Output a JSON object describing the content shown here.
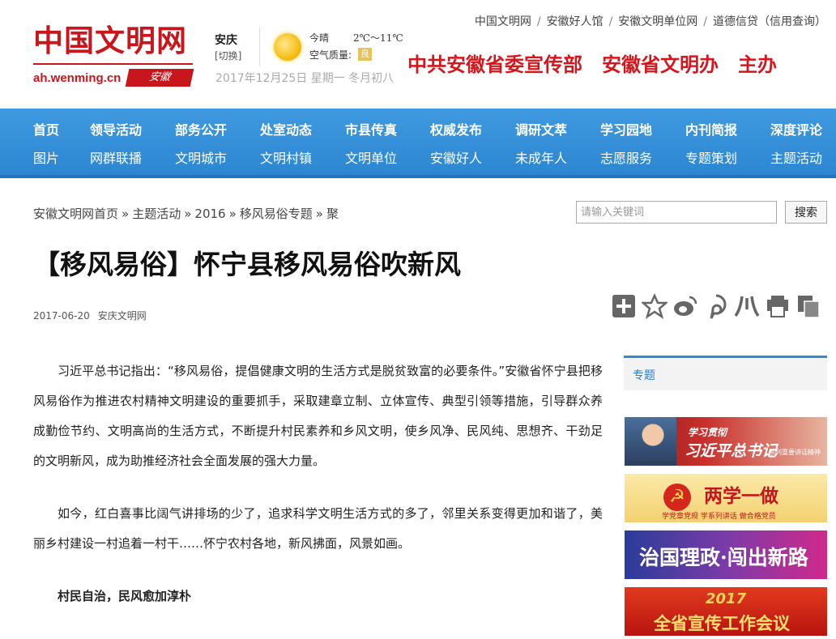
{
  "header": {
    "logo_title": "中国文明网",
    "logo_domain": "ah.wenming.cn",
    "logo_region": "安徽",
    "city": "安庆",
    "city_switch": "[切换]",
    "weather_now": "今晴",
    "weather_temp": "2℃～11℃",
    "air_label": "空气质量:",
    "air_value": "良",
    "date_line": "2017年12月25日  星期一  冬月初八",
    "top_links": [
      "中国文明网",
      "安徽好人馆",
      "安徽文明单位网",
      "道德信贷（信用查询）"
    ],
    "slogan": [
      "中共安徽省委宣传部",
      "安徽省文明办",
      "主办"
    ]
  },
  "nav": {
    "row1": [
      "首页",
      "领导活动",
      "部务公开",
      "处室动态",
      "市县传真",
      "权威发布",
      "调研文萃",
      "学习园地",
      "内刊简报",
      "深度评论"
    ],
    "row2": [
      "图片",
      "网群联播",
      "文明城市",
      "文明村镇",
      "文明单位",
      "安徽好人",
      "未成年人",
      "志愿服务",
      "专题策划",
      "主题活动"
    ]
  },
  "breadcrumb": [
    "安徽文明网首页",
    "主题活动",
    "2016",
    "移风易俗专题",
    "聚"
  ],
  "search": {
    "placeholder": "请输入关键词",
    "button": "搜索"
  },
  "article": {
    "title": "【移风易俗】怀宁县移风易俗吹新风",
    "date": "2017-06-20",
    "source": "安庆文明网",
    "paragraphs": [
      "习近平总书记指出：“移风易俗，提倡健康文明的生活方式是脱贫致富的必要条件。”安徽省怀宁县把移风易俗作为推进农村精神文明建设的重要抓手，采取建章立制、立体宣传、典型引领等措施，引导群众养成勤俭节约、文明高尚的生活方式，不断提升村民素养和乡风文明，使乡风净、民风纯、思想齐、干劲足的文明新风，成为助推经济社会全面发展的强大力量。",
      "如今，红白喜事比阔气讲排场的少了，追求科学文明生活方式的多了，邻里关系变得更加和谐了，美丽乡村建设一村追着一村干……怀宁农村各地，新风拂面，风景如画。"
    ],
    "subheading": "村民自治，民风愈加淳朴"
  },
  "share_icons": [
    "plus-icon",
    "star-icon",
    "weibo-icon",
    "pinterest-icon",
    "renren-icon",
    "print-icon",
    "copy-icon"
  ],
  "sidebar": {
    "tab_label": "专题",
    "banners": [
      {
        "line1": "学习贯彻",
        "line2": "习近平总书记",
        "line3": "系列重要讲话精神"
      },
      {
        "line1": "两学一做",
        "line2": "学党章党规  学系列讲话  做合格党员"
      },
      {
        "line1": "治国理政·闯出新路"
      },
      {
        "line1": "2017",
        "line2": "全省宣传工作会议"
      }
    ]
  }
}
